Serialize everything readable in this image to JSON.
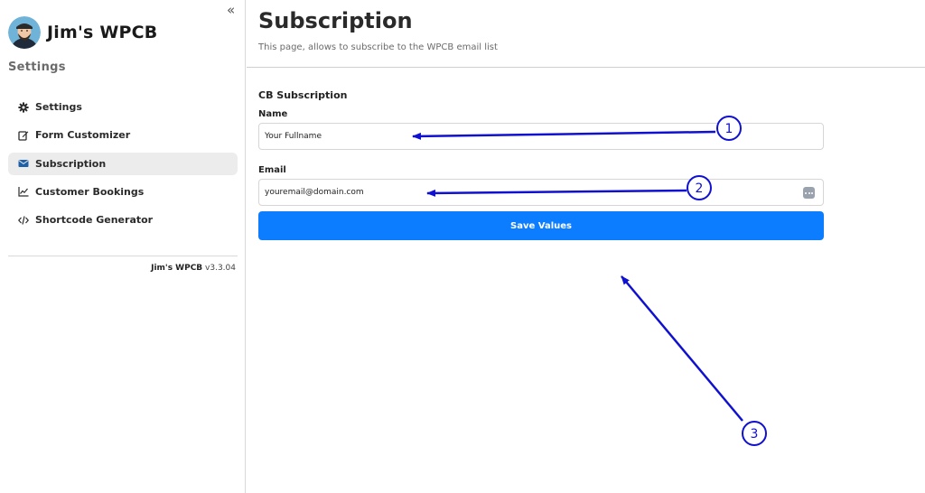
{
  "sidebar": {
    "brand_name": "Jim's WPCB",
    "section_title": "Settings",
    "collapse_glyph": "«",
    "items": [
      {
        "label": "Settings",
        "icon": "gear-icon"
      },
      {
        "label": "Form Customizer",
        "icon": "edit-icon"
      },
      {
        "label": "Subscription",
        "icon": "envelope-icon",
        "active": true
      },
      {
        "label": "Customer Bookings",
        "icon": "line-chart-icon"
      },
      {
        "label": "Shortcode Generator",
        "icon": "code-icon"
      }
    ],
    "version_name": "Jim's WPCB",
    "version_number": "v3.3.04"
  },
  "header": {
    "title": "Subscription",
    "subtitle": "This page, allows to subscribe to the WPCB email list"
  },
  "form": {
    "title": "CB Subscription",
    "name_label": "Name",
    "name_value": "Your Fullname",
    "email_label": "Email",
    "email_value": "youremail@domain.com",
    "save_label": "Save Values"
  },
  "annotations": {
    "callout_1": "1",
    "callout_2": "2",
    "callout_3": "3",
    "color": "#1010d0"
  },
  "colors": {
    "accent": "#0d7dff",
    "active_nav_bg": "#ececec"
  }
}
